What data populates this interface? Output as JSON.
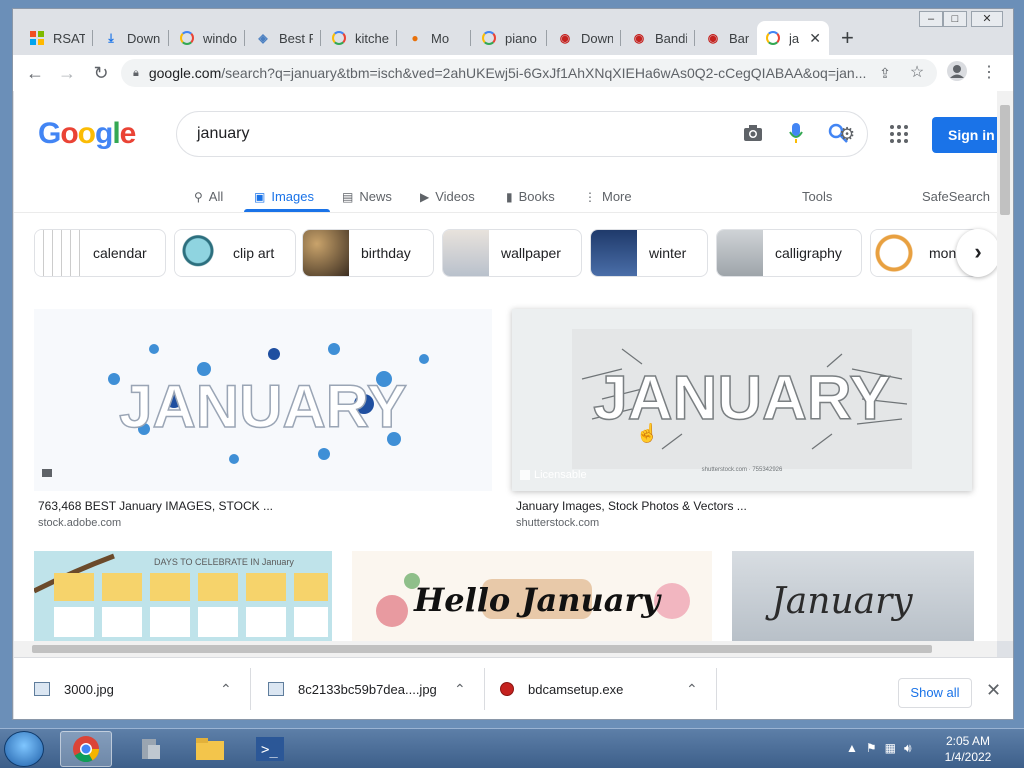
{
  "browser": {
    "tabs": [
      {
        "label": "RSAT",
        "icon": "windows-logo-icon"
      },
      {
        "label": "Downl",
        "icon": "download-icon"
      },
      {
        "label": "windo",
        "icon": "google-icon"
      },
      {
        "label": "Best F",
        "icon": "web-icon"
      },
      {
        "label": "kitche",
        "icon": "google-icon"
      },
      {
        "label": "Mo",
        "icon": "site-icon"
      },
      {
        "label": "piano",
        "icon": "google-icon"
      },
      {
        "label": "Down",
        "icon": "bandicam-icon"
      },
      {
        "label": "Bandi",
        "icon": "bandicam-icon"
      },
      {
        "label": "Bandi",
        "icon": "bandicam-icon"
      },
      {
        "label": "jar",
        "icon": "google-icon",
        "active": true
      }
    ],
    "url_host": "google.com",
    "url_rest": "/search?q=january&tbm=isch&ved=2ahUKEwj5i-6GxJf1AhXNqXIEHa6wAs0Q2-cCegQIABAA&oq=jan..."
  },
  "google": {
    "logo": "Google",
    "query": "january",
    "signin": "Sign in",
    "nav": [
      {
        "label": "All",
        "icon": "search-icon"
      },
      {
        "label": "Images",
        "icon": "image-icon",
        "active": true
      },
      {
        "label": "News",
        "icon": "news-icon"
      },
      {
        "label": "Videos",
        "icon": "play-icon"
      },
      {
        "label": "Books",
        "icon": "book-icon"
      },
      {
        "label": "More",
        "icon": "more-vert-icon"
      }
    ],
    "tools": "Tools",
    "safesearch": "SafeSearch",
    "chips": [
      "calendar",
      "clip art",
      "birthday",
      "wallpaper",
      "winter",
      "calligraphy",
      "mon"
    ],
    "results": [
      {
        "title": "763,468 BEST January IMAGES, STOCK ...",
        "source": "stock.adobe.com",
        "image_text": "JANUARY"
      },
      {
        "title": "January Images, Stock Photos & Vectors ...",
        "source": "shutterstock.com",
        "image_text": "JANUARY",
        "badge": "Licensable",
        "watermark": "shutterstock.com · 755342926"
      }
    ],
    "row2": [
      {
        "image_text": "DAYS TO CELEBRATE IN January"
      },
      {
        "image_text": "Hello January"
      },
      {
        "image_text": "January"
      }
    ]
  },
  "downloads": {
    "items": [
      "3000.jpg",
      "8c2133bc59b7dea....jpg",
      "bdcamsetup.exe"
    ],
    "show_all": "Show all"
  },
  "taskbar": {
    "time": "2:05 AM",
    "date": "1/4/2022"
  },
  "colors": {
    "google_blue": "#4285f4",
    "google_red": "#ea4335",
    "google_yellow": "#fbbc05",
    "google_green": "#34a853",
    "link_blue": "#1a73e8"
  }
}
